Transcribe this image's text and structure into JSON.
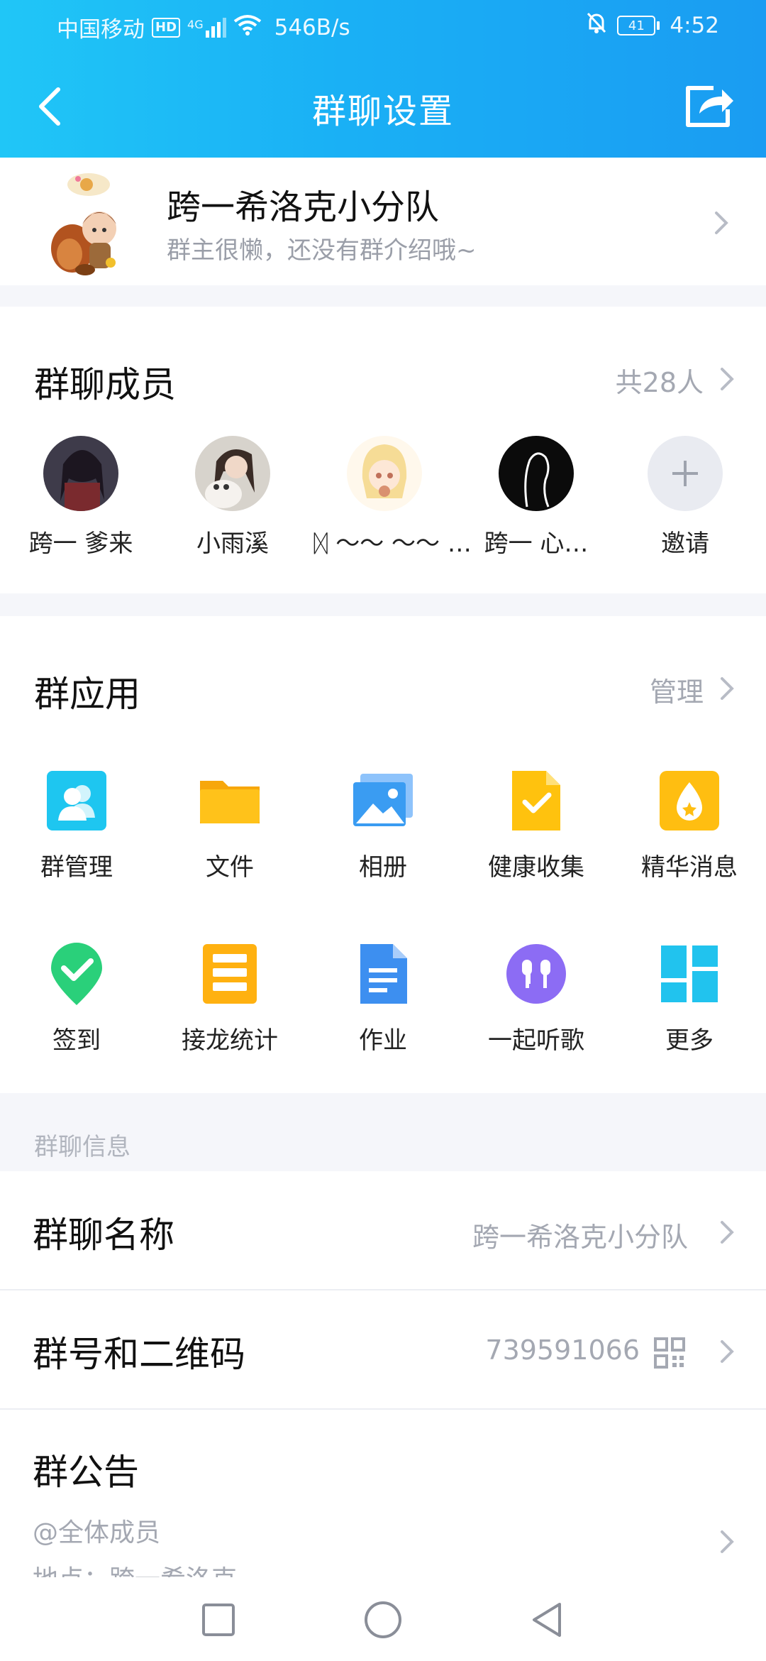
{
  "status_bar": {
    "carrier": "中国移动",
    "hd": "HD",
    "signal": "4G",
    "speed": "546B/s",
    "battery": "41",
    "time": "4:52"
  },
  "header": {
    "title": "群聊设置"
  },
  "group": {
    "name": "跨一希洛克小分队",
    "description": "群主很懒，还没有群介绍哦~"
  },
  "members": {
    "title": "群聊成员",
    "count": "共28人",
    "items": [
      {
        "name": "跨一 爹来"
      },
      {
        "name": "小雨溪"
      },
      {
        "name": "ᛞ 〜〜 〜〜 …"
      },
      {
        "name": "跨一 心…"
      }
    ],
    "invite_label": "邀请"
  },
  "apps": {
    "title": "群应用",
    "manage": "管理",
    "items": [
      {
        "label": "群管理",
        "icon": "group-manage-icon",
        "color": "#1ec6f0"
      },
      {
        "label": "文件",
        "icon": "folder-icon",
        "color": "#ffbf0f"
      },
      {
        "label": "相册",
        "icon": "photo-album-icon",
        "color": "#3a9cf2"
      },
      {
        "label": "健康收集",
        "icon": "health-collect-icon",
        "color": "#ffc20e"
      },
      {
        "label": "精华消息",
        "icon": "essence-message-icon",
        "color": "#ffbe11"
      },
      {
        "label": "签到",
        "icon": "check-in-icon",
        "color": "#2ad07a"
      },
      {
        "label": "接龙统计",
        "icon": "relay-stats-icon",
        "color": "#ffb110"
      },
      {
        "label": "作业",
        "icon": "homework-icon",
        "color": "#3d8ff0"
      },
      {
        "label": "一起听歌",
        "icon": "listen-together-icon",
        "color": "#8c6cf4"
      },
      {
        "label": "更多",
        "icon": "more-grid-icon",
        "color": "#21c3ee"
      }
    ]
  },
  "info": {
    "section_label": "群聊信息",
    "name_title": "群聊名称",
    "name_value": "跨一希洛克小分队",
    "number_title": "群号和二维码",
    "number_value": "739591066",
    "notice_title": "群公告",
    "notice_line1": "@全体成员",
    "notice_line2": "地点：跨一希洛克"
  }
}
